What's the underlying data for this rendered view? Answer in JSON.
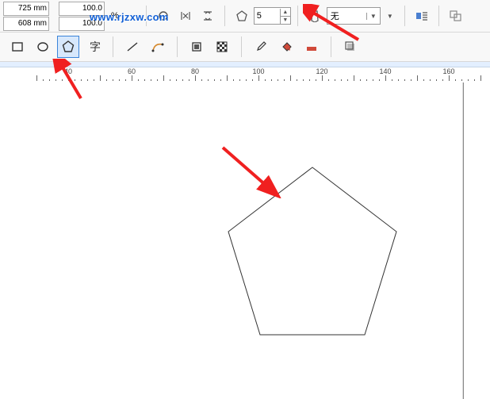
{
  "coords": {
    "x": "725 mm",
    "y": "608 mm"
  },
  "scale": {
    "x": "100.0",
    "y": "100.0",
    "unit": "%"
  },
  "watermark": "www.rjzxw.com",
  "sides": {
    "value": "5"
  },
  "outline": {
    "label": "无"
  },
  "ruler": {
    "labels": [
      "40",
      "60",
      "80",
      "100",
      "120",
      "140",
      "160"
    ]
  }
}
